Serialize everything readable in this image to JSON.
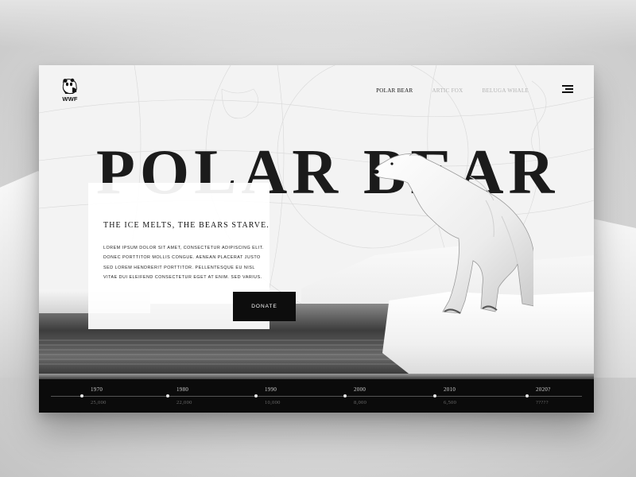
{
  "brand": {
    "logo_text": "WWF"
  },
  "nav": {
    "items": [
      {
        "label": "POLAR BEAR",
        "active": true
      },
      {
        "label": "ARTIC FOX",
        "active": false
      },
      {
        "label": "BELUGA WHALE",
        "active": false
      }
    ]
  },
  "hero": {
    "title": "POLAR BEAR",
    "tagline": "THE ICE MELTS, THE BEARS STARVE.",
    "body": "LOREM IPSUM DOLOR SIT AMET, CONSECTETUR ADIPISCING ELIT. DONEC PORTTITOR MOLLIS CONGUE. AENEAN PLACERAT JUSTO SED LOREM HENDRERIT PORTTITOR. PELLENTESQUE EU NISL VITAE DUI ELEIFEND CONSECTETUR EGET AT ENIM. SED VARIUS.",
    "donate_label": "DONATE"
  },
  "timeline": [
    {
      "year": "1970",
      "count": "25,000"
    },
    {
      "year": "1980",
      "count": "22,000"
    },
    {
      "year": "1990",
      "count": "10,000"
    },
    {
      "year": "2000",
      "count": "8,000"
    },
    {
      "year": "2010",
      "count": "6,500"
    },
    {
      "year": "2020?",
      "count": "?????"
    }
  ],
  "colors": {
    "accent": "#0d0d0d",
    "text": "#1b1b1b",
    "muted_nav": "#b3b3b3",
    "timeline_bg": "#0b0b0b"
  },
  "icons": {
    "logo": "panda-icon",
    "menu": "hamburger-menu-icon"
  }
}
